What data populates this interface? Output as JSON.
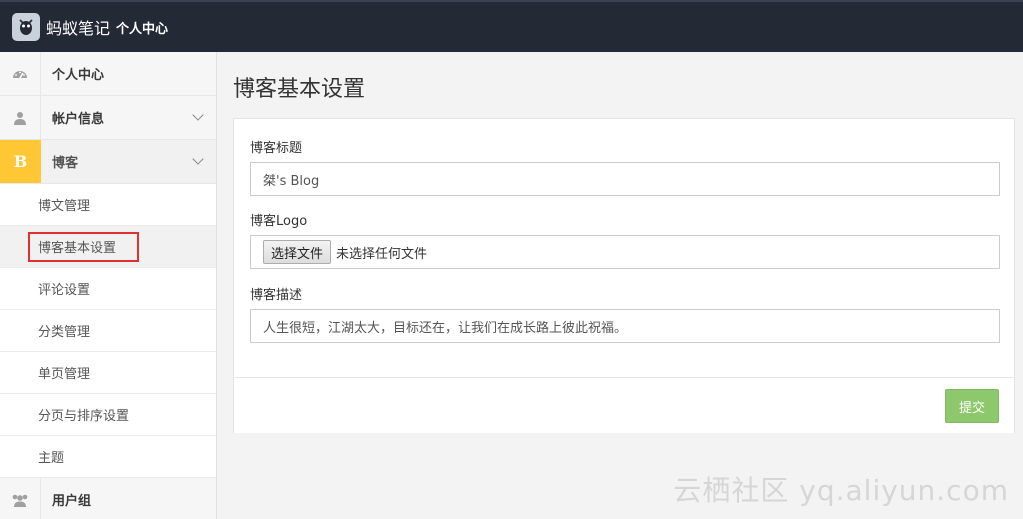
{
  "header": {
    "brand": "蚂蚁笔记",
    "subtitle": "个人中心"
  },
  "sidebar": {
    "items": [
      {
        "icon": "dashboard-icon",
        "label": "个人中心"
      },
      {
        "icon": "user-icon",
        "label": "帐户信息"
      },
      {
        "icon": "blog-b-icon",
        "icon_text": "B",
        "label": "博客"
      },
      {
        "icon": "users-icon",
        "label": "用户组"
      }
    ],
    "blog_sub": [
      "博文管理",
      "博客基本设置",
      "评论设置",
      "分类管理",
      "单页管理",
      "分页与排序设置",
      "主题"
    ]
  },
  "main": {
    "title": "博客基本设置",
    "fields": {
      "title_label": "博客标题",
      "title_value": "桀's Blog",
      "logo_label": "博客Logo",
      "logo_button": "选择文件",
      "logo_status": "未选择任何文件",
      "desc_label": "博客描述",
      "desc_value": "人生很短，江湖太大，目标还在，让我们在成长路上彼此祝福。"
    },
    "submit_label": "提交"
  },
  "watermark": "云栖社区 yq.aliyun.com",
  "colors": {
    "topbar": "#232a35",
    "active_icon": "#ffc734",
    "submit": "#8dc86c",
    "highlight": "#e0302f"
  }
}
